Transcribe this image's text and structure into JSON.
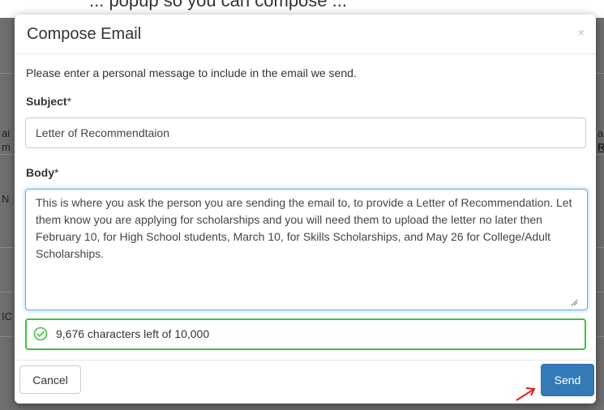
{
  "background": {
    "cut_text": "... popup so you can compose ...",
    "fragments": [
      "ai",
      "m",
      "N",
      "IC",
      "ai",
      "RE"
    ]
  },
  "modal": {
    "title": "Compose Email",
    "close_glyph": "×",
    "intro": "Please enter a personal message to include in the email we send.",
    "subject_label": "Subject",
    "body_label": "Body",
    "required_mark": "*",
    "subject_value": "Letter of Recommendtaion",
    "body_value": "This is where you ask the person you are sending the email to, to provide a Letter of Recommendation. Let them know you are applying for scholarships and you will need them to upload the letter no later then February 10, for High School students, March 10, for Skills Scholarships, and May 26 for College/Adult Scholarships.",
    "counter_text": "9,676 characters left of 10,000",
    "cancel_label": "Cancel",
    "send_label": "Send"
  },
  "colors": {
    "primary": "#337ab7",
    "success_border": "#3fc13f",
    "focus_border": "#66afe9",
    "annotation_arrow": "#e02020"
  },
  "icons": {
    "close": "close-icon",
    "counter_status": "check-circle-icon",
    "annotation": "red-arrow-icon"
  }
}
